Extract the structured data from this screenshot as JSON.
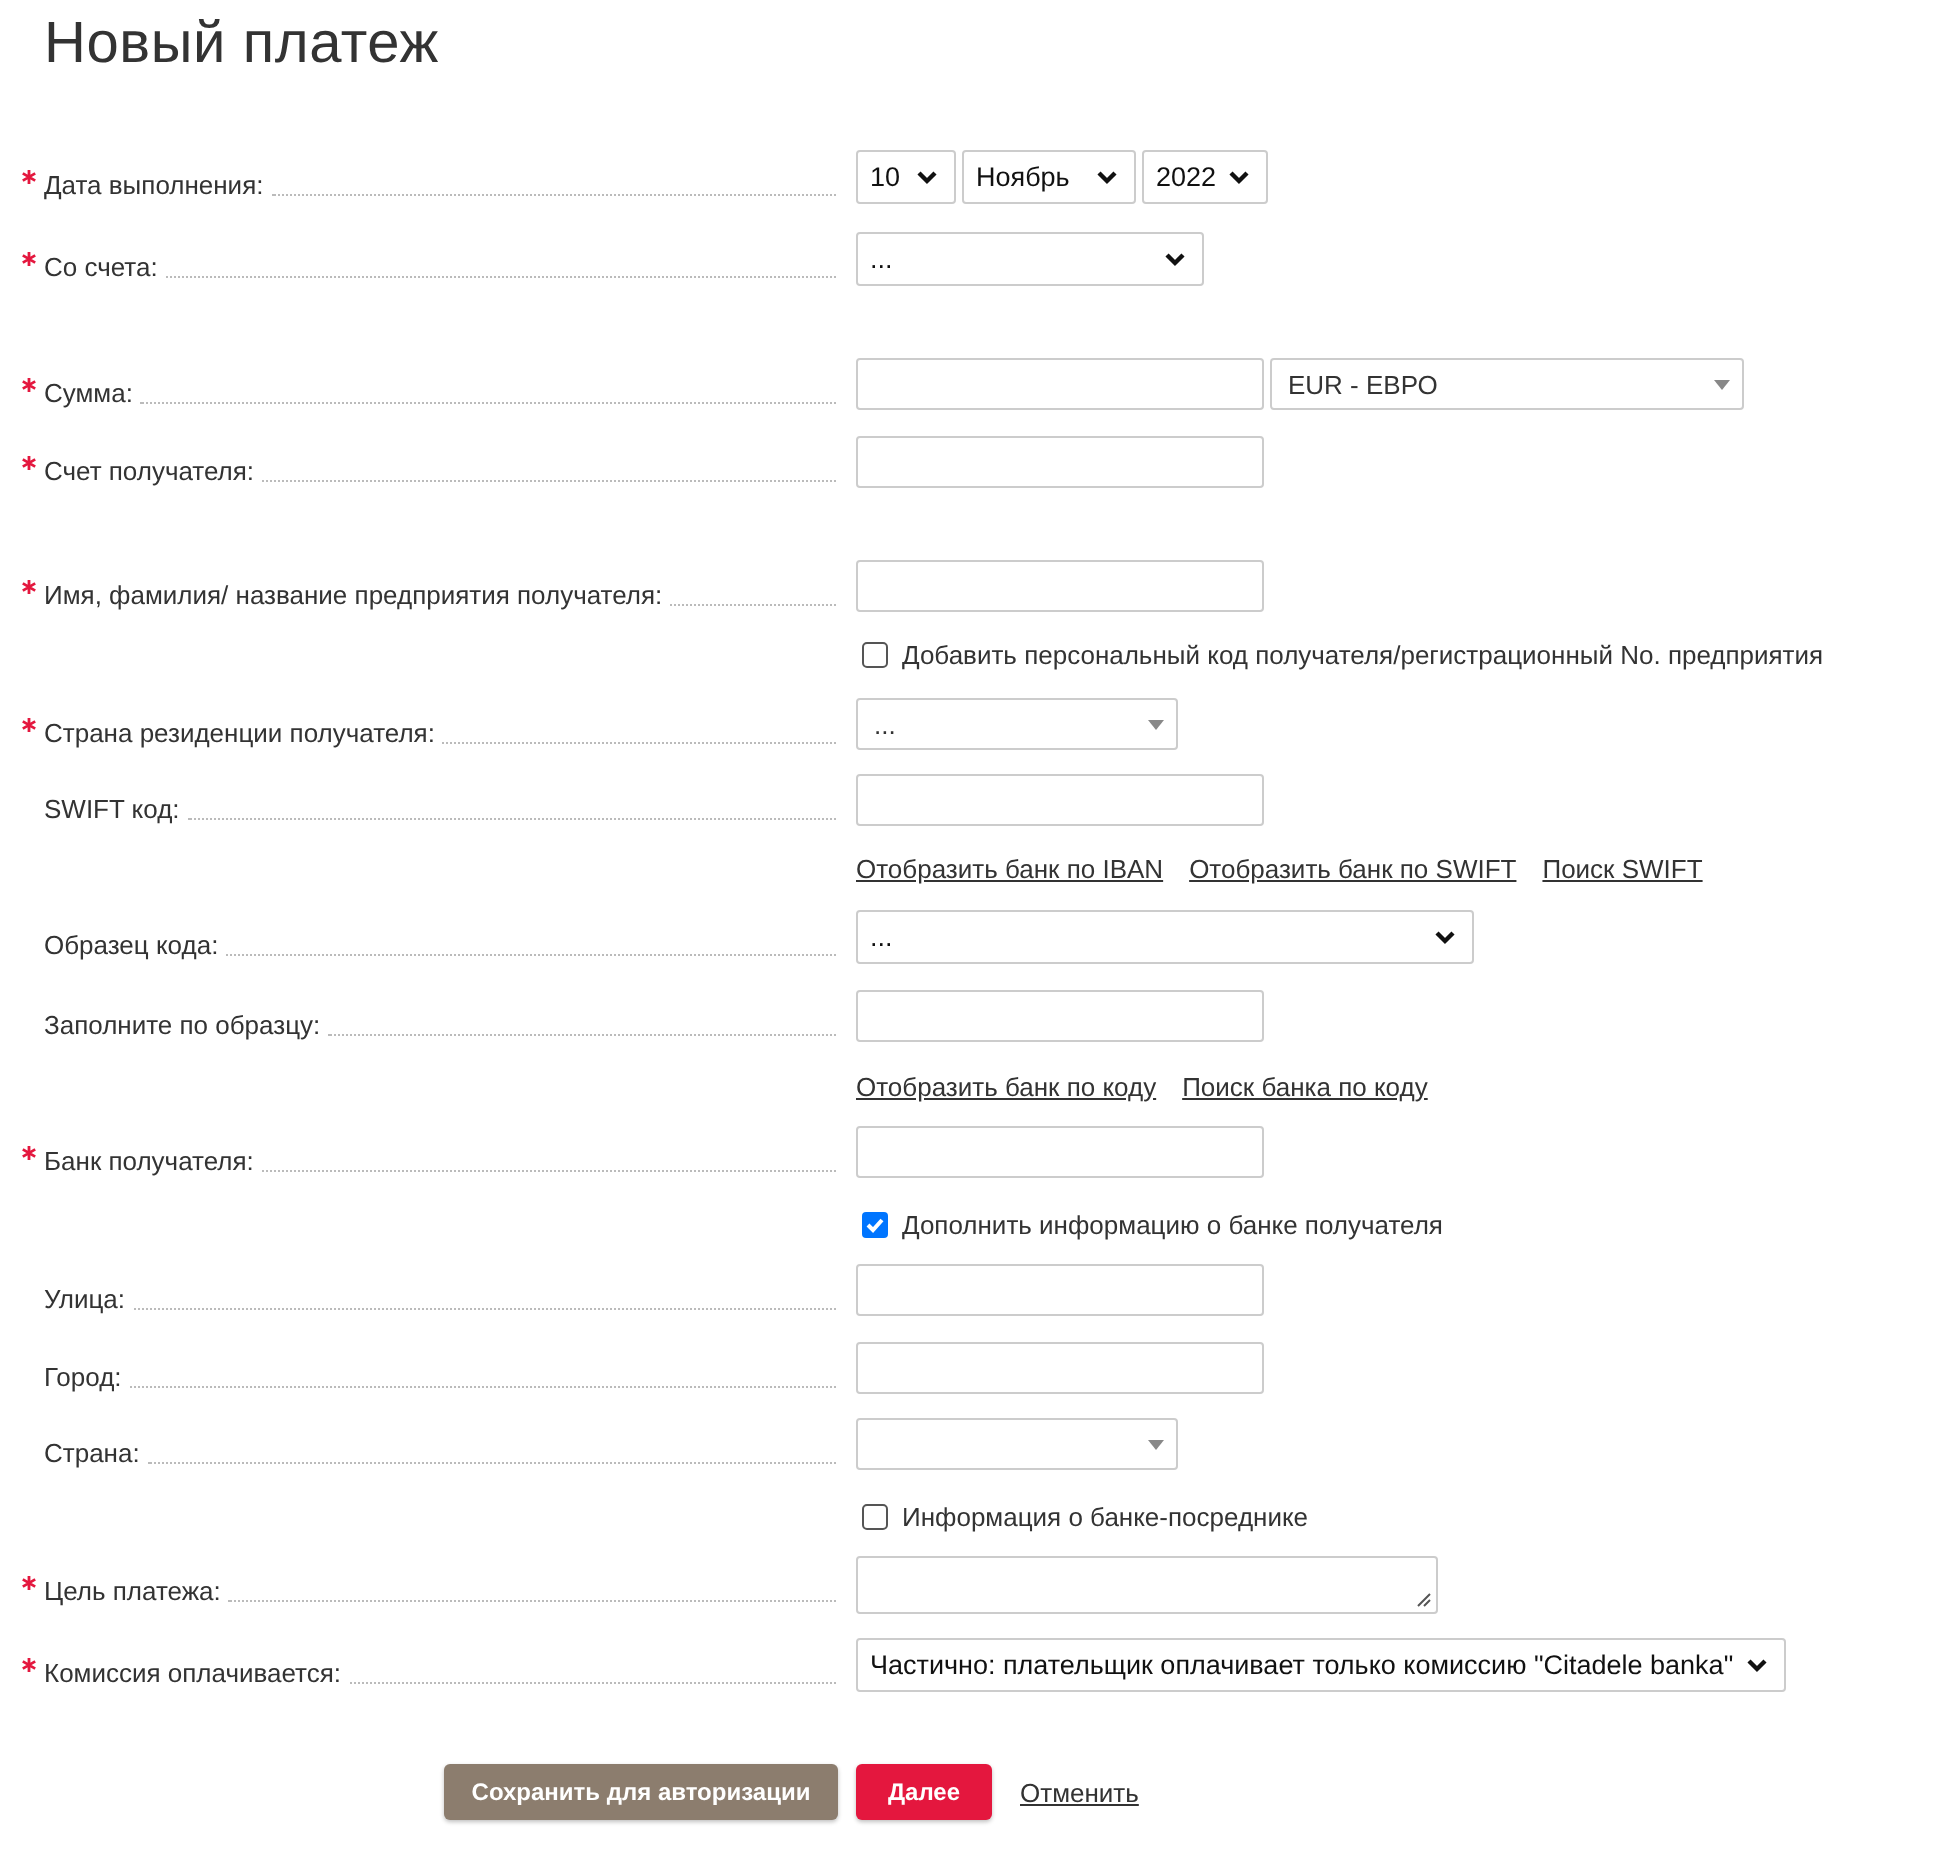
{
  "title": "Новый платеж",
  "rows": [
    {
      "kind": "field",
      "label": "Дата выполнения:",
      "required": true,
      "controls": [
        {
          "kind": "select",
          "value": "10"
        },
        {
          "kind": "select",
          "value": "Ноябрь"
        },
        {
          "kind": "select",
          "value": "2022"
        }
      ]
    },
    {
      "kind": "field",
      "label": "Со счета:",
      "required": true,
      "controls": [
        {
          "kind": "select",
          "value": "..."
        }
      ]
    },
    {
      "kind": "field",
      "label": "Сумма:",
      "required": true,
      "controls": [
        {
          "kind": "input"
        },
        {
          "kind": "combo",
          "value": "EUR - ЕВРО"
        }
      ]
    },
    {
      "kind": "field",
      "label": "Счет получателя:",
      "required": true,
      "controls": [
        {
          "kind": "input"
        }
      ]
    },
    {
      "kind": "field",
      "label": "Имя, фамилия/ название предприятия получателя:",
      "required": true,
      "controls": [
        {
          "kind": "input"
        }
      ]
    },
    {
      "kind": "checkbox",
      "label": "Добавить персональный код получателя/регистрационный No. предприятия",
      "checked": false
    },
    {
      "kind": "field",
      "label": "Страна резиденции получателя:",
      "required": true,
      "controls": [
        {
          "kind": "combo",
          "value": "..."
        }
      ]
    },
    {
      "kind": "field",
      "label": "SWIFT код:",
      "required": false,
      "controls": [
        {
          "kind": "input"
        }
      ]
    },
    {
      "kind": "links",
      "links": [
        "Отобразить банк по IBAN",
        "Отобразить банк по SWIFT",
        "Поиск SWIFT"
      ]
    },
    {
      "kind": "field",
      "label": "Образец кода:",
      "required": false,
      "controls": [
        {
          "kind": "select",
          "value": "..."
        }
      ]
    },
    {
      "kind": "field",
      "label": "Заполните по образцу:",
      "required": false,
      "controls": [
        {
          "kind": "input"
        }
      ]
    },
    {
      "kind": "links",
      "links": [
        "Отобразить банк по коду",
        "Поиск банка по коду"
      ]
    },
    {
      "kind": "field",
      "label": "Банк получателя:",
      "required": true,
      "controls": [
        {
          "kind": "input"
        }
      ]
    },
    {
      "kind": "checkbox",
      "label": "Дополнить информацию о банке получателя",
      "checked": true
    },
    {
      "kind": "field",
      "label": "Улица:",
      "required": false,
      "controls": [
        {
          "kind": "input"
        }
      ]
    },
    {
      "kind": "field",
      "label": "Город:",
      "required": false,
      "controls": [
        {
          "kind": "input"
        }
      ]
    },
    {
      "kind": "field",
      "label": "Страна:",
      "required": false,
      "controls": [
        {
          "kind": "combo"
        }
      ]
    },
    {
      "kind": "checkbox",
      "label": "Информация о банке-посреднике",
      "checked": false
    },
    {
      "kind": "field",
      "label": "Цель платежа:",
      "required": true,
      "controls": [
        {
          "kind": "textarea"
        }
      ]
    },
    {
      "kind": "field",
      "label": "Комиссия оплачивается:",
      "required": true,
      "controls": [
        {
          "kind": "select",
          "value": "Частично: плательщик оплачивает только комиссию \"Citadele banka\""
        }
      ]
    }
  ],
  "buttons": [
    {
      "kind": "secondary",
      "label": "Сохранить для авторизации"
    },
    {
      "kind": "primary",
      "label": "Далее"
    },
    {
      "kind": "link",
      "label": "Отменить"
    }
  ]
}
